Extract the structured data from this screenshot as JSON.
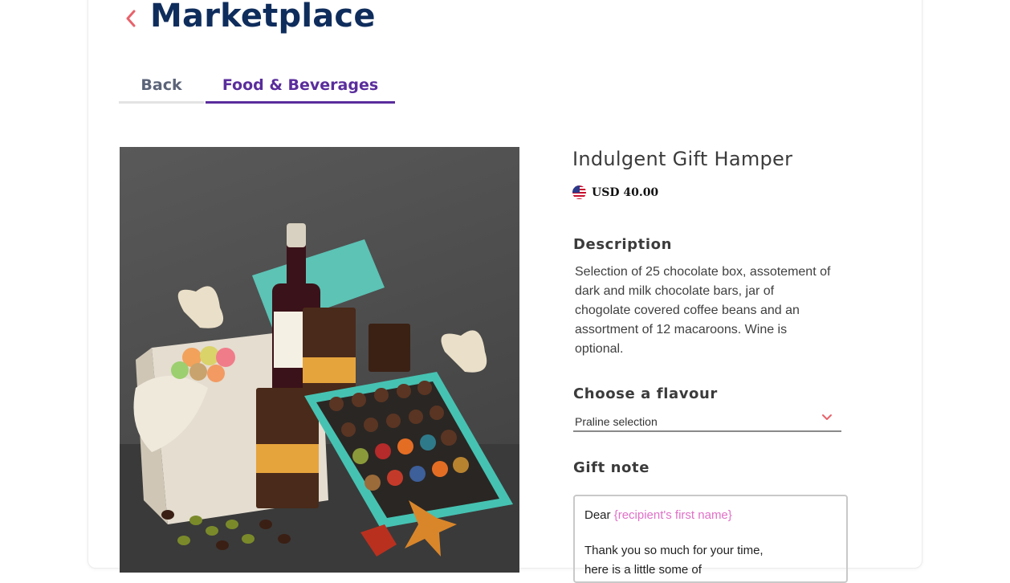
{
  "header": {
    "title": "Marketplace"
  },
  "tabs": [
    {
      "label": "Back",
      "active": false
    },
    {
      "label": "Food & Beverages",
      "active": true
    }
  ],
  "product": {
    "name": "Indulgent Gift Hamper",
    "price": "USD 40.00",
    "currency_flag": "us-flag-icon",
    "description_label": "Description",
    "description": "Selection of 25 chocolate box, assotement of dark and milk chocolate bars, jar of chogolate covered coffee beans and an assortment of 12 macaroons. Wine is optional."
  },
  "flavour": {
    "label": "Choose a flavour",
    "selected": "Praline selection"
  },
  "gift_note": {
    "label": "Gift note",
    "greeting": "Dear",
    "recipient_token": "{recipient's first name}",
    "line2": "Thank you so much for your time,",
    "line3": "here is a little",
    "line3_more": "some of"
  },
  "colors": {
    "title": "#0f2d5c",
    "accent_purple": "#5a2d9c",
    "back_chevron": "#e8626b",
    "placeholder_pink": "#e070c7"
  }
}
